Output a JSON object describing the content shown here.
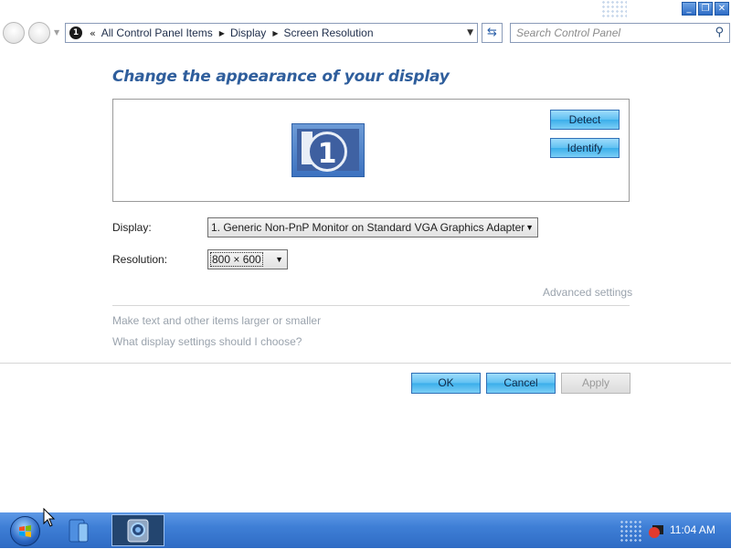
{
  "window": {
    "controls": {
      "minimize": "_",
      "restore": "❐",
      "close": "✕"
    }
  },
  "nav": {
    "back_icon": "back-arrow-icon",
    "forward_icon": "forward-arrow-icon",
    "address_prefix": "«",
    "breadcrumbs": [
      "All Control Panel Items",
      "Display",
      "Screen Resolution"
    ],
    "search_placeholder": "Search Control Panel"
  },
  "main": {
    "title": "Change the appearance of your display",
    "monitor_number": "1",
    "detect_label": "Detect",
    "identify_label": "Identify",
    "display_label": "Display:",
    "display_value": "1. Generic Non-PnP Monitor on Standard VGA Graphics Adapter",
    "resolution_label": "Resolution:",
    "resolution_value": "800 × 600",
    "advanced_link": "Advanced settings",
    "links": [
      "Make text and other items larger or smaller",
      "What display settings should I choose?"
    ],
    "ok_label": "OK",
    "cancel_label": "Cancel",
    "apply_label": "Apply"
  },
  "taskbar": {
    "clock": "11:04 AM"
  },
  "colors": {
    "title_blue": "#2f5e9c",
    "button_aqua": "#5fc0f2",
    "taskbar_blue": "#3f7fd6",
    "link_gray": "#9aa3ad"
  }
}
